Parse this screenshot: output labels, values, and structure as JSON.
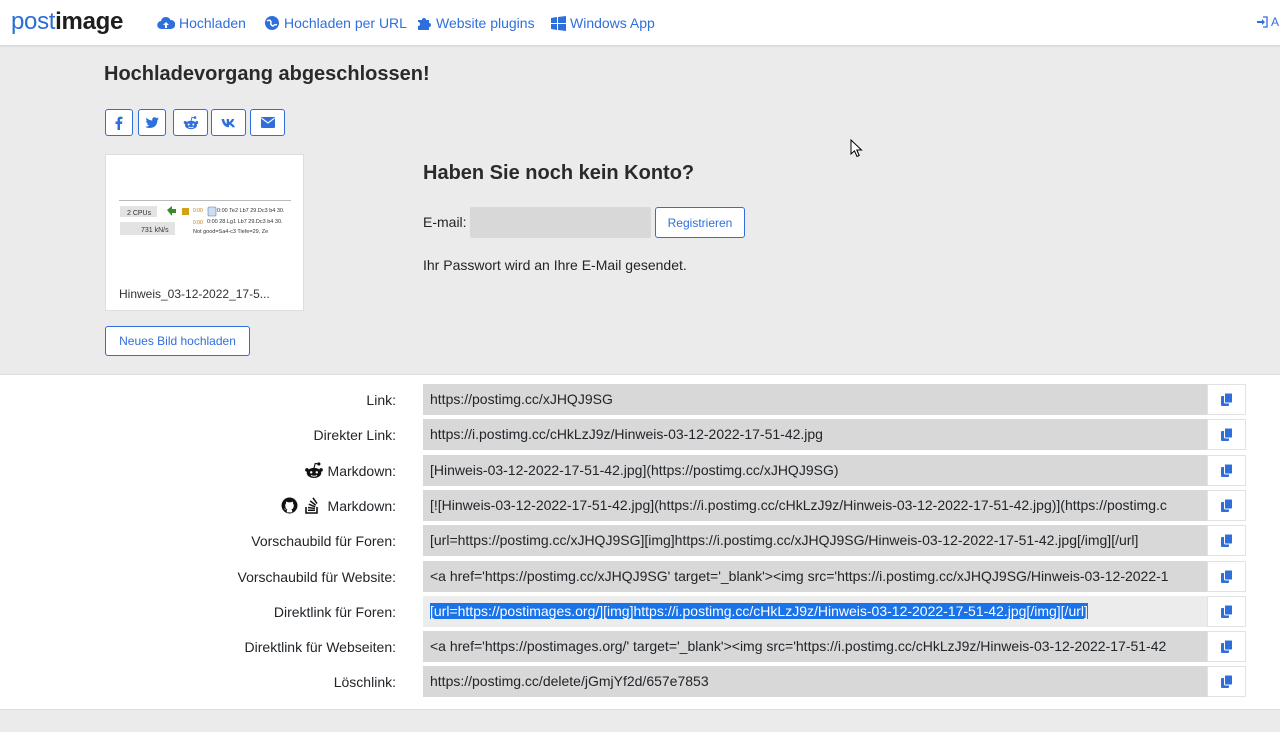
{
  "nav": {
    "logo_part1": "post",
    "logo_part2": "image",
    "items": [
      "Hochladen",
      "Hochladen per URL",
      "Website plugins",
      "Windows App"
    ],
    "login_label": "A"
  },
  "upload": {
    "heading": "Hochladevorgang abgeschlossen!",
    "share_icons": [
      "facebook-icon",
      "twitter-icon",
      "reddit-icon",
      "vk-icon",
      "email-icon"
    ],
    "thumbnail": {
      "name": "Hinweis_03-12-2022_17-5...",
      "cpus_label": "2 CPUs",
      "speed_label": "731 kN/s",
      "line1": "0:00  Te2 Lb7 29.Dc3 b4 30.",
      "line2": "0:00  28.Lg1 Lb7 29.Dc3 b4 30.",
      "line3": "Not good=Sa4-c3 Tiefe=29, Ze"
    },
    "new_upload_label": "Neues Bild hochladen"
  },
  "account": {
    "title": "Haben Sie noch kein Konto?",
    "email_label": "E-mail:",
    "email_value": "",
    "register_label": "Registrieren",
    "password_note": "Ihr Passwort wird an Ihre E-Mail gesendet."
  },
  "links": [
    {
      "label": "Link:",
      "value": "https://postimg.cc/xJHQJ9SG"
    },
    {
      "label": "Direkter Link:",
      "value": "https://i.postimg.cc/cHkLzJ9z/Hinweis-03-12-2022-17-51-42.jpg"
    },
    {
      "label": "Markdown:",
      "value": "[Hinweis-03-12-2022-17-51-42.jpg](https://postimg.cc/xJHQJ9SG)"
    },
    {
      "label": "Markdown:",
      "value": "[![Hinweis-03-12-2022-17-51-42.jpg](https://i.postimg.cc/cHkLzJ9z/Hinweis-03-12-2022-17-51-42.jpg)](https://postimg.c"
    },
    {
      "label": "Vorschaubild für Foren:",
      "value": "[url=https://postimg.cc/xJHQJ9SG][img]https://i.postimg.cc/xJHQJ9SG/Hinweis-03-12-2022-17-51-42.jpg[/img][/url]"
    },
    {
      "label": "Vorschaubild für Website:",
      "value": "<a href='https://postimg.cc/xJHQJ9SG' target='_blank'><img src='https://i.postimg.cc/xJHQJ9SG/Hinweis-03-12-2022-1"
    },
    {
      "label": "Direktlink für Foren:",
      "value": "[url=https://postimages.org/][img]https://i.postimg.cc/cHkLzJ9z/Hinweis-03-12-2022-17-51-42.jpg[/img][/url]"
    },
    {
      "label": "Direktlink für Webseiten:",
      "value": "<a href='https://postimages.org/' target='_blank'><img src='https://i.postimg.cc/cHkLzJ9z/Hinweis-03-12-2022-17-51-42"
    },
    {
      "label": "Löschlink:",
      "value": "https://postimg.cc/delete/jGmjYf2d/657e7853"
    }
  ],
  "colors": {
    "accent": "#2f6fdc",
    "panel_bg": "#ebebeb",
    "field_bg": "#d8d8d8",
    "selection": "#1a73e8"
  }
}
